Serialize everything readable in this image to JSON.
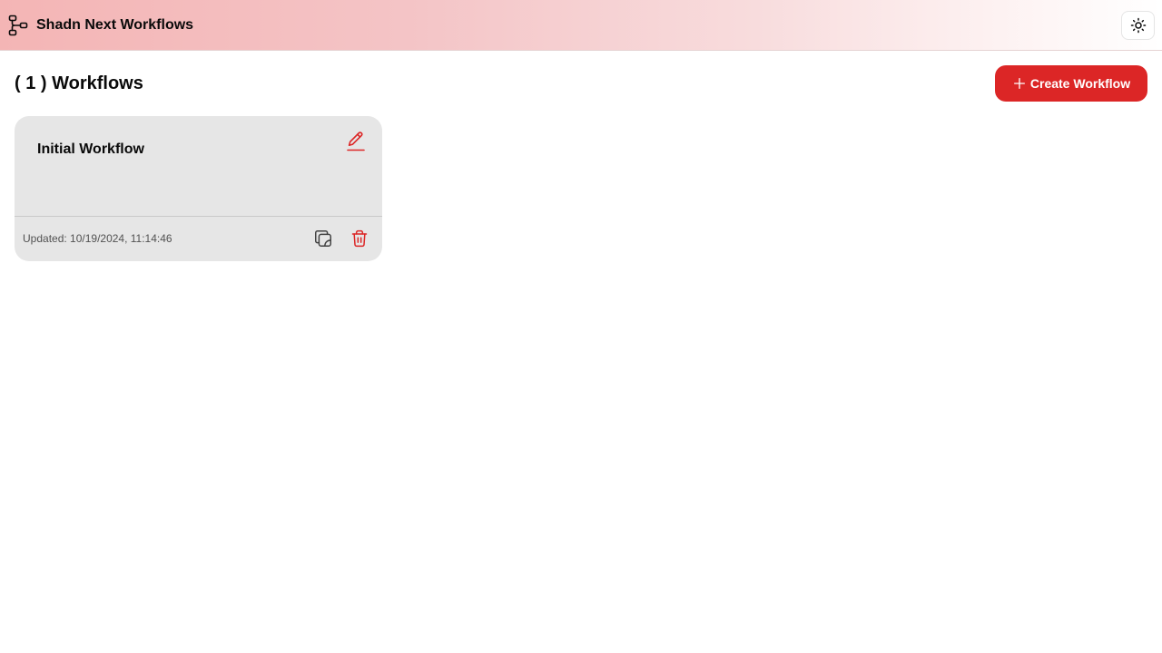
{
  "header": {
    "app_title": "Shadn Next Workflows",
    "logo_icon": "workflow-icon",
    "theme_toggle_icon": "sun-icon"
  },
  "main": {
    "heading": "( 1 ) Workflows",
    "create_button": {
      "label": "Create Workflow",
      "icon": "plus-icon"
    }
  },
  "workflows": [
    {
      "title": "Initial Workflow",
      "updated": "Updated: 10/19/2024, 11:14:46",
      "actions": [
        "edit-icon",
        "copy-icon",
        "trash-icon"
      ]
    }
  ],
  "colors": {
    "accent": "#dc2626",
    "card_background": "#e6e6e6",
    "header_gradient_start": "#f4b5b5"
  }
}
